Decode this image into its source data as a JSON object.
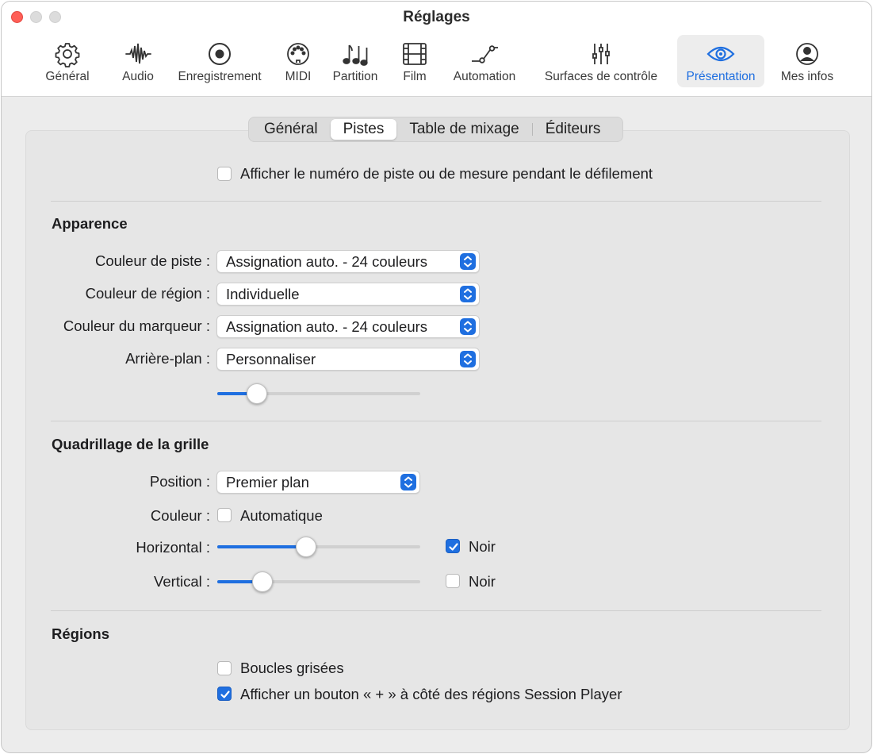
{
  "window": {
    "title": "Réglages"
  },
  "toolbar": {
    "items": [
      {
        "label": "Général",
        "icon": "gear-icon"
      },
      {
        "label": "Audio",
        "icon": "waveform-icon"
      },
      {
        "label": "Enregistrement",
        "icon": "record-icon"
      },
      {
        "label": "MIDI",
        "icon": "midi-port-icon"
      },
      {
        "label": "Partition",
        "icon": "music-notes-icon"
      },
      {
        "label": "Film",
        "icon": "film-icon"
      },
      {
        "label": "Automation",
        "icon": "automation-curve-icon"
      },
      {
        "label": "Surfaces de contrôle",
        "icon": "faders-icon"
      },
      {
        "label": "Présentation",
        "icon": "eye-icon"
      },
      {
        "label": "Mes infos",
        "icon": "person-icon"
      }
    ],
    "active": "Présentation"
  },
  "tabs": {
    "items": [
      "Général",
      "Pistes",
      "Table de mixage",
      "Éditeurs"
    ],
    "active": "Pistes"
  },
  "top_option": {
    "label": "Afficher le numéro de piste ou de mesure pendant le défilement",
    "checked": false
  },
  "appearance": {
    "heading": "Apparence",
    "track_color": {
      "label": "Couleur de piste :",
      "value": "Assignation auto. - 24 couleurs"
    },
    "region_color": {
      "label": "Couleur de région :",
      "value": "Individuelle"
    },
    "marker_color": {
      "label": "Couleur du marqueur :",
      "value": "Assignation auto. - 24 couleurs"
    },
    "background": {
      "label": "Arrière-plan :",
      "value": "Personnaliser"
    },
    "background_slider_level": 0.16
  },
  "grid": {
    "heading": "Quadrillage de la grille",
    "position": {
      "label": "Position :",
      "value": "Premier plan"
    },
    "color": {
      "label": "Couleur :",
      "checkbox_label": "Automatique",
      "checked": false
    },
    "horizontal": {
      "label": "Horizontal :",
      "level": 0.43,
      "black_label": "Noir",
      "black_checked": true
    },
    "vertical": {
      "label": "Vertical :",
      "level": 0.19,
      "black_label": "Noir",
      "black_checked": false
    }
  },
  "regions": {
    "heading": "Régions",
    "gray_loops": {
      "label": "Boucles grisées",
      "checked": false
    },
    "plus_button": {
      "label": "Afficher un bouton « + » à côté des régions Session Player",
      "checked": true
    }
  },
  "colors": {
    "accent": "#1f6fe0",
    "close": "#ff5f57"
  }
}
